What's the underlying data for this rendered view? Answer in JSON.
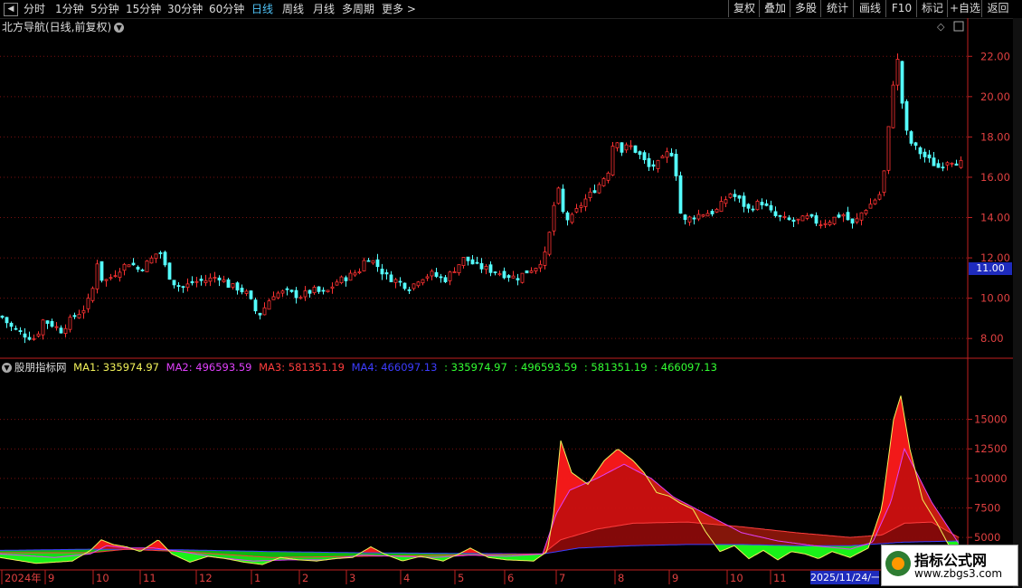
{
  "toolbar": {
    "periods": [
      "分时",
      "1分钟",
      "5分钟",
      "15分钟",
      "30分钟",
      "60分钟",
      "日线",
      "周线",
      "月线",
      "多周期",
      "更多 >"
    ],
    "active_period": "日线",
    "right_buttons": [
      "复权",
      "叠加",
      "多股",
      "统计",
      "画线",
      "F10",
      "标记",
      "+自选",
      "返回"
    ]
  },
  "main_chart": {
    "title": "北方导航(日线,前复权)",
    "y_ticks": [
      "22.00",
      "20.00",
      "18.00",
      "16.00",
      "14.00",
      "12.00",
      "10.00",
      "8.00"
    ],
    "current_price": "11.00"
  },
  "indicator": {
    "name": "股朋指标网",
    "legend": [
      {
        "label": "MA1: 335974.97",
        "color": "#f2f25a"
      },
      {
        "label": "MA2: 496593.59",
        "color": "#e040fb"
      },
      {
        "label": "MA3: 581351.19",
        "color": "#ff3d3d"
      },
      {
        "label": "MA4: 466097.13",
        "color": "#3d3dff"
      },
      {
        "label": ": 335974.97",
        "color": "#33ff33"
      },
      {
        "label": ": 496593.59",
        "color": "#33ff33"
      },
      {
        "label": ": 581351.19",
        "color": "#33ff33"
      },
      {
        "label": ": 466097.13",
        "color": "#33ff33"
      }
    ],
    "y_ticks": [
      "15000",
      "12500",
      "10000",
      "7500",
      "5000"
    ]
  },
  "x_axis": {
    "labels": [
      "2024年",
      "9",
      "10",
      "11",
      "12",
      "1",
      "2",
      "3",
      "4",
      "5",
      "6",
      "7",
      "8",
      "9",
      "10",
      "11"
    ],
    "cursor_date": "2025/11/24/一"
  },
  "colors": {
    "up": "#ff3232",
    "down": "#54ffff",
    "grid": "#7a1010",
    "axis": "#c02020"
  },
  "watermark": {
    "line1": "指标公式网",
    "line2": "www.zbgs3.com"
  },
  "chart_data": {
    "type": "candlestick",
    "price_ylim": [
      7.2,
      23.0
    ],
    "price_series": [
      [
        0,
        9.1
      ],
      [
        10,
        8.6
      ],
      [
        20,
        8.3
      ],
      [
        30,
        8.1
      ],
      [
        38,
        8.0
      ],
      [
        46,
        8.9
      ],
      [
        56,
        8.7
      ],
      [
        66,
        8.4
      ],
      [
        78,
        9.0
      ],
      [
        92,
        9.5
      ],
      [
        100,
        10.2
      ],
      [
        106,
        11.8
      ],
      [
        112,
        10.8
      ],
      [
        120,
        11.0
      ],
      [
        132,
        11.5
      ],
      [
        142,
        11.8
      ],
      [
        152,
        11.4
      ],
      [
        165,
        11.9
      ],
      [
        175,
        12.4
      ],
      [
        183,
        11.3
      ],
      [
        190,
        10.8
      ],
      [
        200,
        10.5
      ],
      [
        212,
        10.8
      ],
      [
        228,
        10.9
      ],
      [
        240,
        11.1
      ],
      [
        252,
        10.6
      ],
      [
        262,
        10.5
      ],
      [
        272,
        10.2
      ],
      [
        284,
        9.1
      ],
      [
        292,
        9.6
      ],
      [
        300,
        10.2
      ],
      [
        315,
        10.3
      ],
      [
        330,
        10.1
      ],
      [
        345,
        10.4
      ],
      [
        358,
        10.2
      ],
      [
        370,
        10.8
      ],
      [
        385,
        11.1
      ],
      [
        396,
        11.4
      ],
      [
        404,
        12.1
      ],
      [
        414,
        11.7
      ],
      [
        425,
        11.1
      ],
      [
        440,
        10.8
      ],
      [
        452,
        10.5
      ],
      [
        462,
        11.0
      ],
      [
        476,
        11.2
      ],
      [
        490,
        10.9
      ],
      [
        500,
        11.4
      ],
      [
        512,
        12.0
      ],
      [
        525,
        11.6
      ],
      [
        540,
        11.4
      ],
      [
        555,
        11.2
      ],
      [
        570,
        11.0
      ],
      [
        580,
        11.3
      ],
      [
        592,
        11.6
      ],
      [
        602,
        12.2
      ],
      [
        610,
        14.2
      ],
      [
        614,
        15.8
      ],
      [
        620,
        14.3
      ],
      [
        628,
        13.8
      ],
      [
        640,
        14.6
      ],
      [
        652,
        15.2
      ],
      [
        662,
        15.7
      ],
      [
        672,
        16.4
      ],
      [
        678,
        18.2
      ],
      [
        686,
        17.3
      ],
      [
        694,
        17.6
      ],
      [
        704,
        17.2
      ],
      [
        716,
        16.5
      ],
      [
        728,
        16.7
      ],
      [
        740,
        17.4
      ],
      [
        748,
        15.8
      ],
      [
        752,
        13.7
      ],
      [
        762,
        14.0
      ],
      [
        775,
        14.2
      ],
      [
        790,
        14.3
      ],
      [
        806,
        15.2
      ],
      [
        815,
        14.9
      ],
      [
        826,
        14.4
      ],
      [
        840,
        14.8
      ],
      [
        854,
        14.1
      ],
      [
        866,
        13.9
      ],
      [
        878,
        13.8
      ],
      [
        892,
        14.0
      ],
      [
        905,
        13.7
      ],
      [
        918,
        13.9
      ],
      [
        930,
        14.2
      ],
      [
        942,
        13.6
      ],
      [
        952,
        14.3
      ],
      [
        962,
        14.7
      ],
      [
        972,
        15.2
      ],
      [
        978,
        16.8
      ],
      [
        984,
        20.0
      ],
      [
        990,
        22.1
      ],
      [
        994,
        20.8
      ],
      [
        998,
        18.6
      ],
      [
        1004,
        17.8
      ],
      [
        1014,
        17.3
      ],
      [
        1024,
        16.9
      ],
      [
        1036,
        16.5
      ],
      [
        1048,
        16.9
      ],
      [
        1060,
        16.7
      ]
    ],
    "volume_ylim": [
      2400,
      18800
    ],
    "ma1": [
      [
        0,
        3300
      ],
      [
        40,
        2800
      ],
      [
        80,
        3000
      ],
      [
        100,
        3900
      ],
      [
        112,
        4800
      ],
      [
        125,
        4400
      ],
      [
        140,
        4200
      ],
      [
        155,
        3800
      ],
      [
        175,
        4800
      ],
      [
        190,
        3600
      ],
      [
        210,
        2900
      ],
      [
        230,
        3400
      ],
      [
        250,
        3200
      ],
      [
        270,
        2900
      ],
      [
        290,
        2700
      ],
      [
        310,
        3300
      ],
      [
        330,
        3100
      ],
      [
        350,
        3000
      ],
      [
        370,
        3200
      ],
      [
        390,
        3300
      ],
      [
        410,
        4200
      ],
      [
        425,
        3600
      ],
      [
        445,
        3000
      ],
      [
        465,
        3400
      ],
      [
        490,
        3000
      ],
      [
        510,
        3700
      ],
      [
        520,
        4100
      ],
      [
        540,
        3300
      ],
      [
        560,
        3100
      ],
      [
        590,
        3000
      ],
      [
        605,
        3800
      ],
      [
        612,
        7000
      ],
      [
        620,
        13200
      ],
      [
        632,
        10500
      ],
      [
        650,
        9500
      ],
      [
        668,
        11500
      ],
      [
        683,
        12500
      ],
      [
        700,
        11500
      ],
      [
        712,
        10500
      ],
      [
        726,
        8800
      ],
      [
        740,
        8500
      ],
      [
        752,
        7900
      ],
      [
        766,
        7400
      ],
      [
        780,
        5500
      ],
      [
        796,
        3800
      ],
      [
        812,
        4300
      ],
      [
        828,
        3200
      ],
      [
        844,
        3900
      ],
      [
        860,
        3100
      ],
      [
        875,
        3800
      ],
      [
        890,
        3600
      ],
      [
        905,
        3200
      ],
      [
        920,
        3800
      ],
      [
        940,
        3300
      ],
      [
        960,
        4100
      ],
      [
        975,
        7500
      ],
      [
        988,
        15000
      ],
      [
        996,
        17000
      ],
      [
        1006,
        12500
      ],
      [
        1020,
        8200
      ],
      [
        1036,
        6200
      ],
      [
        1050,
        4200
      ],
      [
        1060,
        3200
      ]
    ],
    "ma2": [
      [
        0,
        3600
      ],
      [
        60,
        3300
      ],
      [
        100,
        3600
      ],
      [
        118,
        4300
      ],
      [
        140,
        4100
      ],
      [
        170,
        4100
      ],
      [
        200,
        3800
      ],
      [
        240,
        3300
      ],
      [
        280,
        3000
      ],
      [
        320,
        3100
      ],
      [
        360,
        3100
      ],
      [
        400,
        3500
      ],
      [
        440,
        3400
      ],
      [
        480,
        3300
      ],
      [
        520,
        3500
      ],
      [
        560,
        3400
      ],
      [
        600,
        3600
      ],
      [
        615,
        7000
      ],
      [
        630,
        9000
      ],
      [
        660,
        10000
      ],
      [
        690,
        11200
      ],
      [
        720,
        10000
      ],
      [
        745,
        8400
      ],
      [
        780,
        7000
      ],
      [
        820,
        5400
      ],
      [
        860,
        4700
      ],
      [
        900,
        4300
      ],
      [
        940,
        4000
      ],
      [
        965,
        4600
      ],
      [
        985,
        8000
      ],
      [
        1000,
        12500
      ],
      [
        1030,
        8000
      ],
      [
        1060,
        4500
      ]
    ],
    "ma3": [
      [
        0,
        3700
      ],
      [
        100,
        3700
      ],
      [
        140,
        4000
      ],
      [
        200,
        3800
      ],
      [
        300,
        3300
      ],
      [
        400,
        3400
      ],
      [
        500,
        3500
      ],
      [
        600,
        3600
      ],
      [
        620,
        4800
      ],
      [
        660,
        5700
      ],
      [
        700,
        6200
      ],
      [
        760,
        6300
      ],
      [
        820,
        5900
      ],
      [
        880,
        5400
      ],
      [
        940,
        5000
      ],
      [
        975,
        5200
      ],
      [
        1000,
        6200
      ],
      [
        1030,
        6300
      ],
      [
        1060,
        5000
      ]
    ],
    "ma4": [
      [
        0,
        3900
      ],
      [
        100,
        4000
      ],
      [
        200,
        3950
      ],
      [
        300,
        3800
      ],
      [
        400,
        3700
      ],
      [
        500,
        3650
      ],
      [
        600,
        3600
      ],
      [
        640,
        4100
      ],
      [
        700,
        4300
      ],
      [
        760,
        4400
      ],
      [
        820,
        4400
      ],
      [
        880,
        4300
      ],
      [
        940,
        4300
      ],
      [
        1000,
        4600
      ],
      [
        1060,
        4700
      ]
    ]
  }
}
